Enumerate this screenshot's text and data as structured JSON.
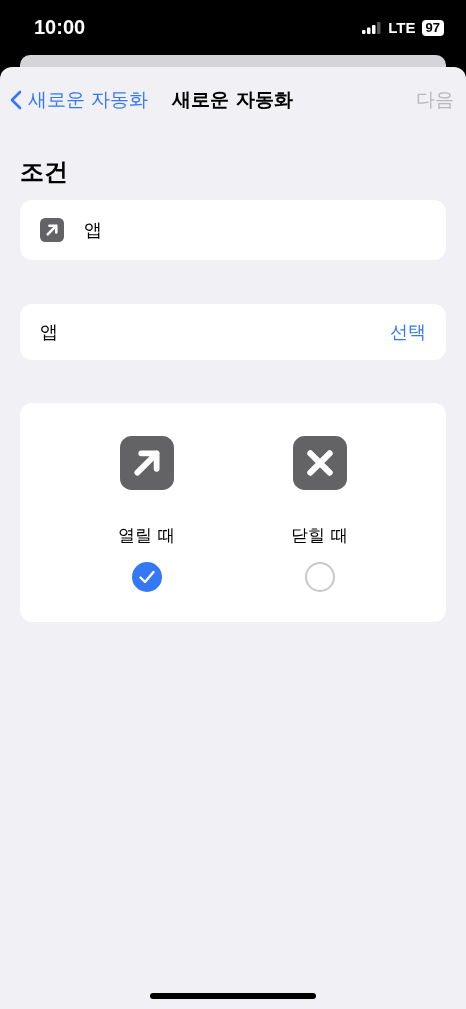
{
  "status_bar": {
    "time": "10:00",
    "network": "LTE",
    "battery": "97"
  },
  "nav": {
    "back_label": "새로운 자동화",
    "title": "새로운 자동화",
    "next_label": "다음",
    "next_disabled": true
  },
  "section_title": "조건",
  "trigger": {
    "label": "앱"
  },
  "app_row": {
    "label": "앱",
    "action": "선택"
  },
  "options": [
    {
      "kind": "open",
      "label": "열릴 때",
      "selected": true
    },
    {
      "kind": "close",
      "label": "닫힐 때",
      "selected": false
    }
  ]
}
